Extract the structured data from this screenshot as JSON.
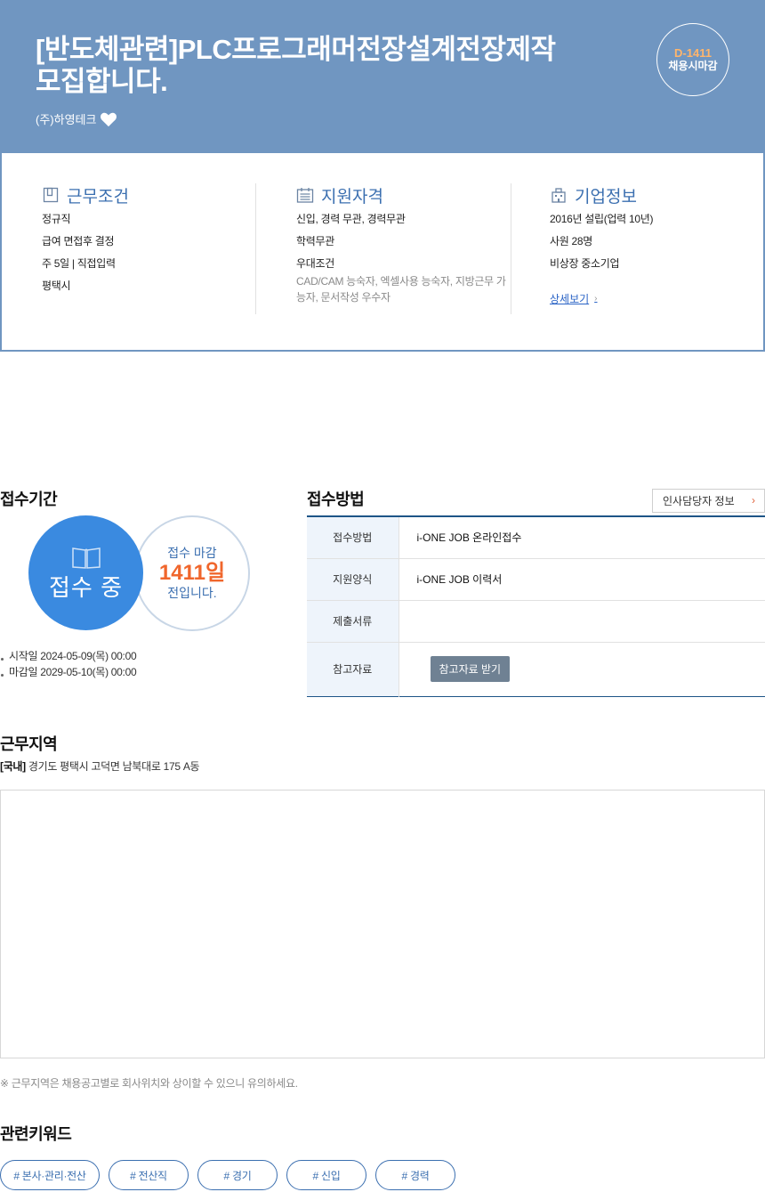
{
  "header": {
    "title": "[반도체관련]PLC프로그래머전장설계전장제작 모집합니다.",
    "company": "(주)하영테크",
    "dday": "D-1411",
    "dday_sub": "채용시마감"
  },
  "summary": {
    "work": {
      "title": "근무조건",
      "items": [
        "정규직",
        "급여 면접후 결정",
        "주 5일 | 직접입력",
        "평택시"
      ]
    },
    "qualification": {
      "title": "지원자격",
      "items": [
        "신입, 경력 무관, 경력무관",
        "학력무관",
        "우대조건"
      ],
      "preferred": "CAD/CAM 능숙자, 엑셀사용 능숙자, 지방근무 가능자, 문서작성 우수자"
    },
    "company": {
      "title": "기업정보",
      "items": [
        "2016년 설립(업력 10년)",
        "사원 28명",
        "비상장 중소기업"
      ],
      "detail_link": "상세보기"
    }
  },
  "period": {
    "title": "접수기간",
    "status": "접수 중",
    "deadline_label": "접수 마감",
    "days_left": "1411일",
    "days_suffix": "전입니다.",
    "start": "시작일 2024-05-09(목) 00:00",
    "end": "마감일 2029-05-10(목) 00:00"
  },
  "method": {
    "title": "접수방법",
    "hr_button": "인사담당자 정보",
    "rows": [
      {
        "label": "접수방법",
        "value": "i-ONE JOB 온라인접수"
      },
      {
        "label": "지원양식",
        "value": "i-ONE JOB 이력서"
      },
      {
        "label": "제출서류",
        "value": ""
      },
      {
        "label": "참고자료",
        "button": "참고자료 받기"
      }
    ]
  },
  "location": {
    "title": "근무지역",
    "region": "[국내]",
    "address": "경기도 평택시 고덕면 남북대로 175 A동",
    "note": "※ 근무지역은 채용공고별로 회사위치와 상이할 수 있으니 유의하세요."
  },
  "keywords": {
    "title": "관련키워드",
    "items": [
      "# 본사·관리·전산",
      "# 전산직",
      "# 경기",
      "# 신입",
      "# 경력"
    ]
  },
  "colors": {
    "banner": "#7096c1",
    "accent_blue": "#3a8ae0",
    "accent_orange": "#f0662c",
    "dday": "#ffb56b"
  },
  "icons": [
    "heart-icon",
    "document-icon",
    "calendar-icon",
    "building-icon",
    "book-icon",
    "chevron-right-icon"
  ]
}
